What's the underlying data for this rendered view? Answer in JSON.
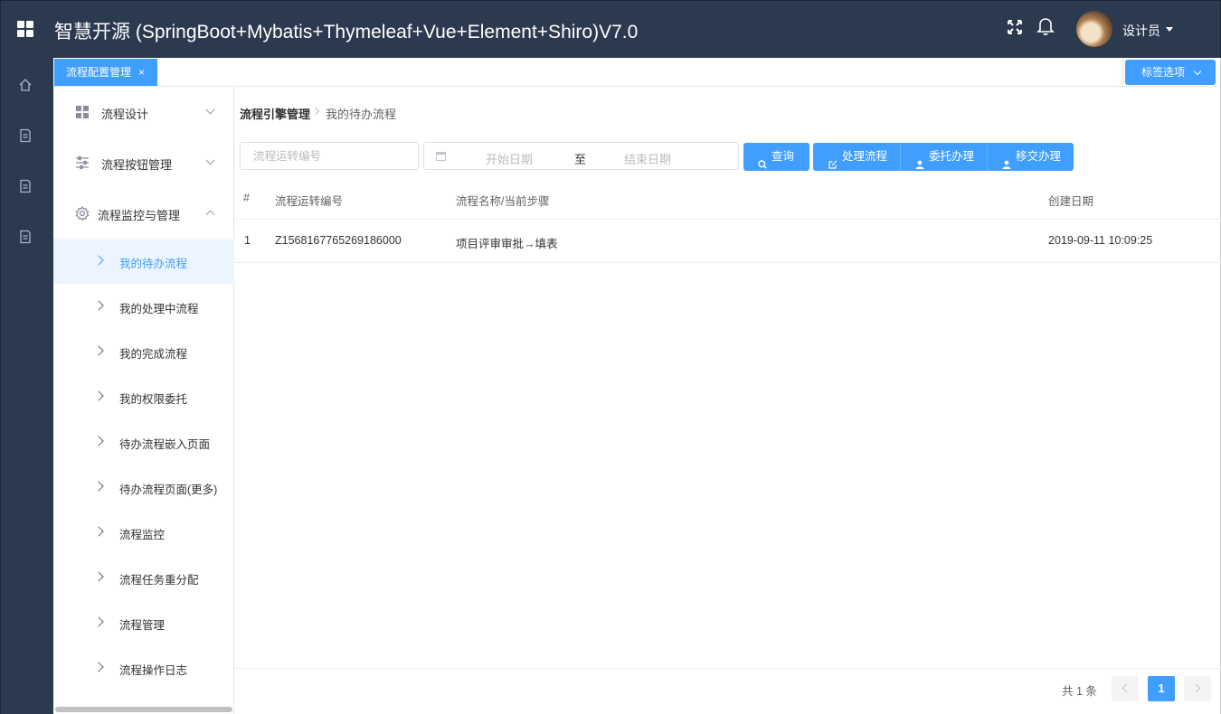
{
  "header": {
    "title": "智慧开源 (SpringBoot+Mybatis+Thymeleaf+Vue+Element+Shiro)V7.0",
    "user_name": "设计员",
    "bg_color": "#2b3a4f"
  },
  "tabs": {
    "active_label": "流程配置管理",
    "close_glyph": "×",
    "options_label": "标签选项"
  },
  "menu": {
    "groups": [
      {
        "label": "流程设计",
        "icon": "grid-icon",
        "expanded": false
      },
      {
        "label": "流程按钮管理",
        "icon": "sliders-icon",
        "expanded": false
      },
      {
        "label": "流程监控与管理",
        "icon": "gear-icon",
        "expanded": true
      }
    ],
    "items": [
      {
        "label": "我的待办流程",
        "active": true
      },
      {
        "label": "我的处理中流程",
        "active": false
      },
      {
        "label": "我的完成流程",
        "active": false
      },
      {
        "label": "我的权限委托",
        "active": false
      },
      {
        "label": "待办流程嵌入页面",
        "active": false
      },
      {
        "label": "待办流程页面(更多)",
        "active": false
      },
      {
        "label": "流程监控",
        "active": false
      },
      {
        "label": "流程任务重分配",
        "active": false
      },
      {
        "label": "流程管理",
        "active": false
      },
      {
        "label": "流程操作日志",
        "active": false
      }
    ]
  },
  "breadcrumb": {
    "root": "流程引擎管理",
    "current": "我的待办流程"
  },
  "filters": {
    "search_placeholder": "流程运转编号",
    "search_value": "",
    "start_placeholder": "开始日期",
    "range_separator": "至",
    "end_placeholder": "结束日期"
  },
  "buttons": {
    "query": "查询",
    "process": "处理流程",
    "delegate": "委托办理",
    "transfer": "移交办理"
  },
  "table": {
    "columns": [
      "#",
      "流程运转编号",
      "流程名称/当前步骤",
      "创建日期"
    ],
    "rows": [
      [
        "1",
        "Z1568167765269186000",
        "项目评审审批→填表",
        "2019-09-11 10:09:25"
      ]
    ]
  },
  "pagination": {
    "total_text": "共 1 条",
    "current_page": "1"
  },
  "colors": {
    "accent": "#409eff",
    "sidebar": "#2b3a4f",
    "active_bg": "#ecf5ff"
  }
}
